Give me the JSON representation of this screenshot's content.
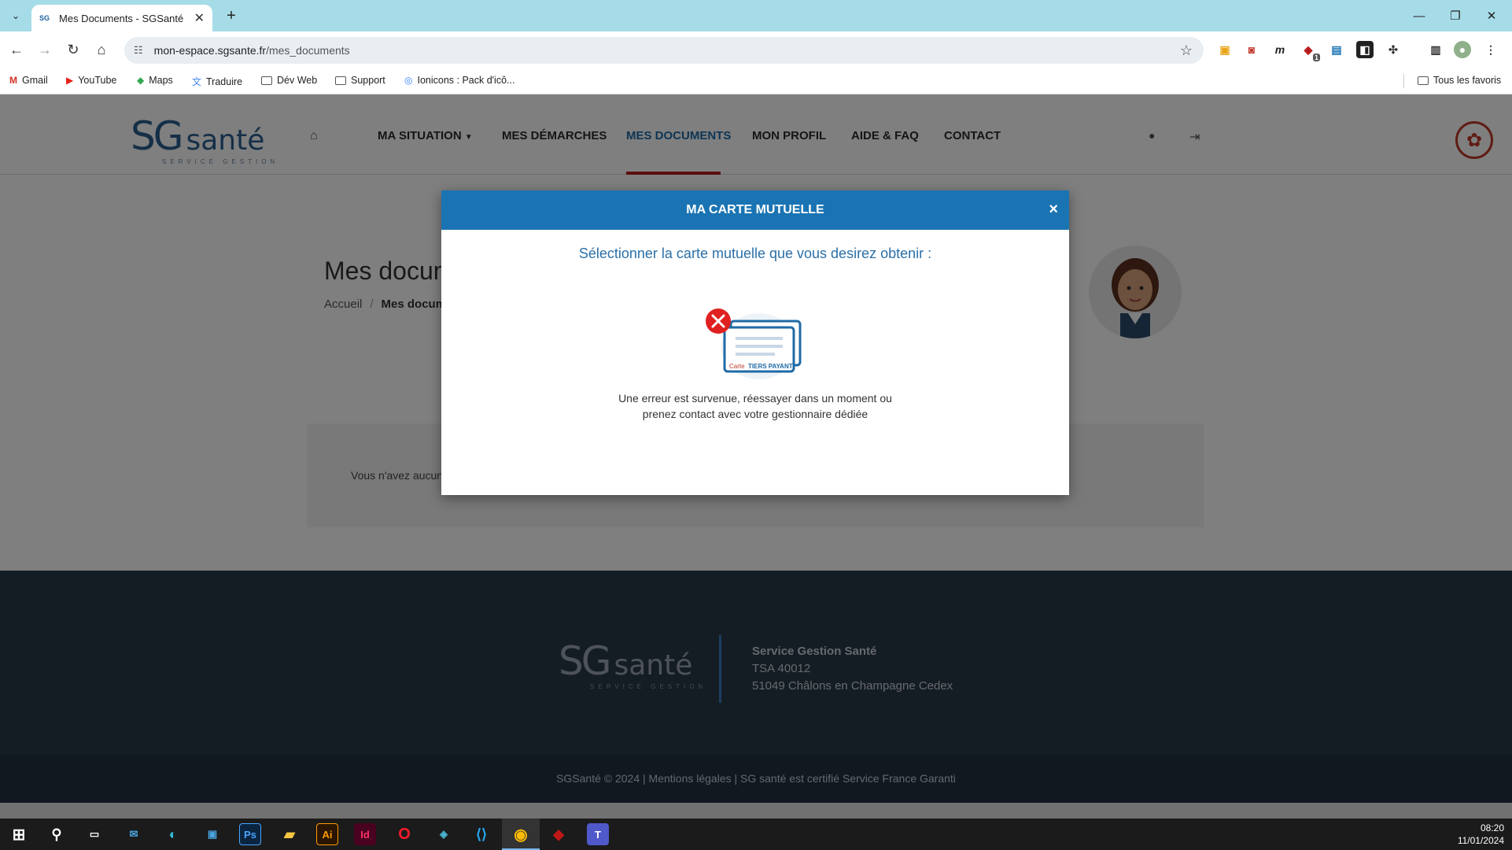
{
  "browser": {
    "tab_title": "Mes Documents - SGSanté",
    "tab_favicon": "SG",
    "url_domain": "mon-espace.sgsante.fr",
    "url_path": "/mes_documents",
    "bookmarks": [
      {
        "label": "Gmail",
        "icon": "gmail-icon"
      },
      {
        "label": "YouTube",
        "icon": "youtube-icon"
      },
      {
        "label": "Maps",
        "icon": "maps-icon"
      },
      {
        "label": "Traduire",
        "icon": "translate-icon"
      },
      {
        "label": "Dév Web",
        "icon": "folder-icon"
      },
      {
        "label": "Support",
        "icon": "folder-icon"
      },
      {
        "label": "Ionicons : Pack d'icô...",
        "icon": "ionicons-icon"
      }
    ],
    "all_bookmarks_label": "Tous les favoris",
    "extension_badge": "1"
  },
  "site": {
    "logo_sg": "SG",
    "logo_sante": "santé",
    "logo_tag": "SERVICE GESTION",
    "nav": {
      "ma_situation": "MA SITUATION",
      "mes_demarches": "MES DÉMARCHES",
      "mes_documents": "MES DOCUMENTS",
      "mon_profil": "MON PROFIL",
      "aide_faq": "AIDE & FAQ",
      "contact": "CONTACT"
    },
    "active_nav": "MES DOCUMENTS",
    "colors": {
      "accent": "#1a74b3",
      "active_underline": "#b71c1c",
      "footer": "#2b3a48"
    }
  },
  "page": {
    "title": "Mes docum",
    "breadcrumb_home": "Accueil",
    "breadcrumb_current": "Mes docume",
    "docs_message": "Vous n'avez aucun"
  },
  "modal": {
    "title": "MA CARTE MUTUELLE",
    "close": "×",
    "subtitle": "Sélectionner la carte mutuelle que vous desirez obtenir :",
    "card_label_carte": "Carte",
    "card_label_tiers": "TIERS PAYANT",
    "error_line1": "Une erreur est survenue, réessayer dans un moment ou",
    "error_line2": "prenez contact avec votre gestionnaire dédiée"
  },
  "footer": {
    "company": "Service Gestion Santé",
    "address1": "TSA 40012",
    "address2": "51049 Châlons en Champagne Cedex",
    "copyright": "SGSanté © 2024 | Mentions légales | SG santé est certifié Service France Garanti"
  },
  "taskbar": {
    "time": "08:20",
    "date": "11/01/2024",
    "apps": [
      "start-icon",
      "search-icon",
      "task-view-icon",
      "mail-icon",
      "edge-icon",
      "store-icon",
      "photoshop-icon",
      "explorer-icon",
      "illustrator-icon",
      "indesign-icon",
      "opera-icon",
      "app-icon",
      "vscode-icon",
      "chrome-icon",
      "mcafee-icon",
      "teams-icon"
    ],
    "app_labels": {
      "photoshop": "Ps",
      "illustrator": "Ai",
      "indesign": "Id"
    }
  }
}
